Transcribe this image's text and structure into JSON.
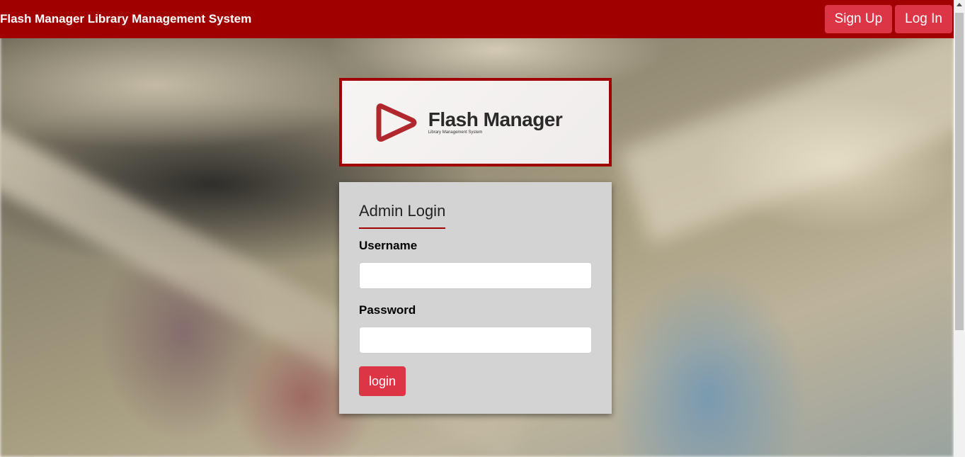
{
  "navbar": {
    "brand": "Flash Manager Library Management System",
    "signup_label": "Sign Up",
    "login_label": "Log In"
  },
  "logo": {
    "title": "Flash Manager",
    "subtitle": "Library Management System",
    "icon": "play-triangle-icon"
  },
  "login_form": {
    "title": "Admin Login",
    "username_label": "Username",
    "username_value": "",
    "password_label": "Password",
    "password_value": "",
    "submit_label": "login"
  },
  "colors": {
    "navbar": "#a10000",
    "button": "#dc3545",
    "card": "#d3d3d3"
  }
}
